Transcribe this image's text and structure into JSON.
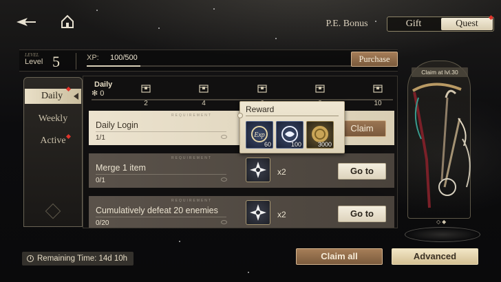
{
  "nav": {
    "back_icon": "back-arrow-icon",
    "home_icon": "home-icon"
  },
  "top_tabs": {
    "pe_bonus": "P.E. Bonus",
    "gift": "Gift",
    "quest": "Quest",
    "active": "Quest"
  },
  "level": {
    "small_caption": "LEVEL",
    "label": "Level",
    "value": "5",
    "xp_label": "XP:",
    "xp_value": "100/500",
    "xp_current": 100,
    "xp_max": 500,
    "purchase": "Purchase"
  },
  "sidebar": {
    "items": [
      {
        "label": "Daily",
        "active": true
      },
      {
        "label": "Weekly",
        "active": false
      },
      {
        "label": "Active",
        "active": false
      }
    ]
  },
  "progress": {
    "title": "Daily",
    "count": "0",
    "ticks": [
      "2",
      "4",
      "6",
      "8",
      "10"
    ]
  },
  "requirement_caption": "REQUIREMENT",
  "tasks": [
    {
      "title": "Daily Login",
      "progress": "1/1",
      "button": "Claim"
    },
    {
      "title": "Merge 1 item",
      "progress": "0/1",
      "reward_mult": "x2",
      "button": "Go to"
    },
    {
      "title": "Cumulatively defeat 20 enemies",
      "progress": "0/20",
      "reward_mult": "x2",
      "button": "Go to"
    }
  ],
  "reward_popup": {
    "title": "Reward",
    "items": [
      {
        "icon": "exp-icon",
        "amount": "60"
      },
      {
        "icon": "currency-token-icon",
        "amount": "100"
      },
      {
        "icon": "gold-coin-icon",
        "amount": "3000"
      }
    ]
  },
  "showcase": {
    "caption": "Claim at lvl.30"
  },
  "footer": {
    "remaining": "Remaining Time: 14d 10h",
    "claim_all": "Claim all",
    "advanced": "Advanced"
  },
  "colors": {
    "accent_brown": "#8a6646",
    "cream": "#ece3cf",
    "red_dot": "#e0342b"
  }
}
